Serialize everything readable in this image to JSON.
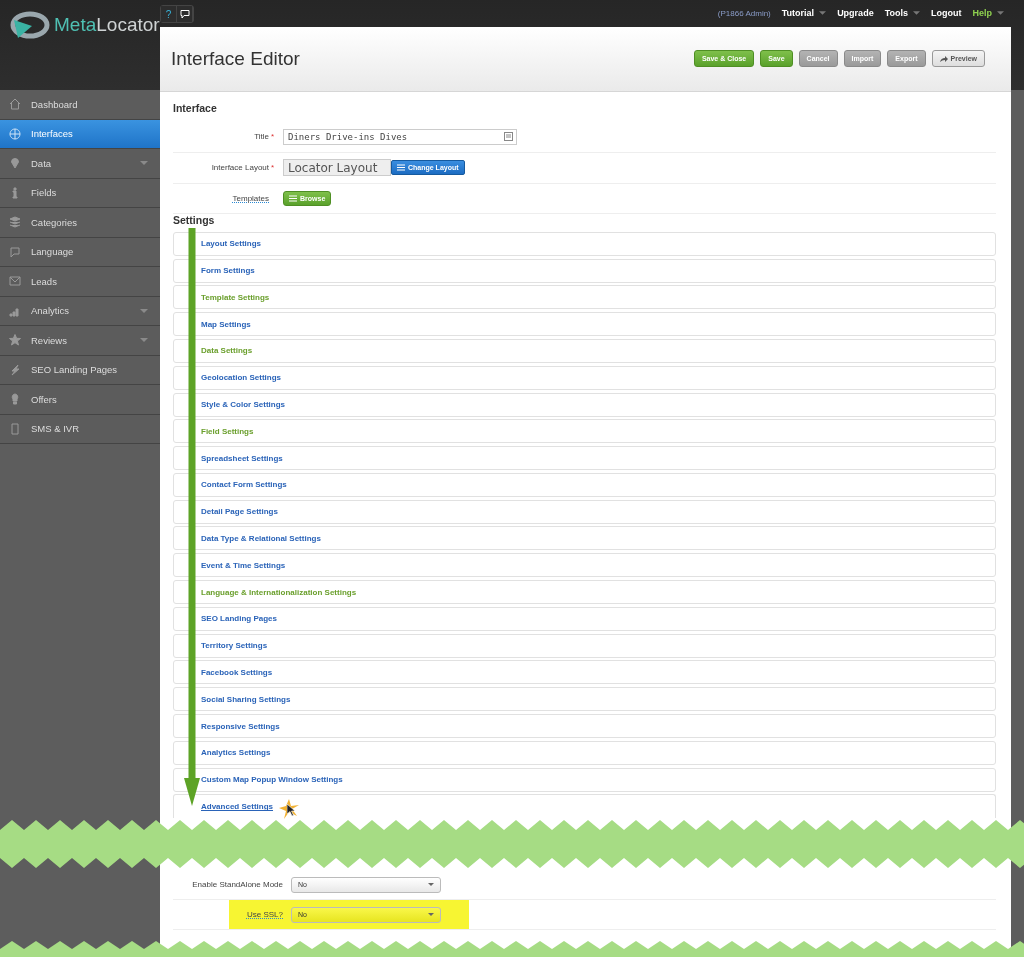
{
  "topbar": {
    "help_buttons": [
      {
        "label": "?"
      }
    ],
    "account": "(P1866 Admin)",
    "menu": [
      {
        "label": "Tutorial",
        "dropdown": true,
        "kind": "normal"
      },
      {
        "label": "Upgrade",
        "dropdown": false,
        "kind": "normal"
      },
      {
        "label": "Tools",
        "dropdown": true,
        "kind": "normal"
      },
      {
        "label": "Logout",
        "dropdown": false,
        "kind": "normal"
      },
      {
        "label": "Help",
        "dropdown": true,
        "kind": "accent"
      }
    ]
  },
  "logo": {
    "part_1": "Meta",
    "part_2": "Locator"
  },
  "sidebar": {
    "items": [
      {
        "label": "Dashboard",
        "selected": false,
        "expandable": false
      },
      {
        "label": "Interfaces",
        "selected": true,
        "expandable": false
      },
      {
        "label": "Data",
        "selected": false,
        "expandable": true
      },
      {
        "label": "Fields",
        "selected": false,
        "expandable": false
      },
      {
        "label": "Categories",
        "selected": false,
        "expandable": false
      },
      {
        "label": "Language",
        "selected": false,
        "expandable": false
      },
      {
        "label": "Leads",
        "selected": false,
        "expandable": false
      },
      {
        "label": "Analytics",
        "selected": false,
        "expandable": true
      },
      {
        "label": "Reviews",
        "selected": false,
        "expandable": true
      },
      {
        "label": "SEO Landing Pages",
        "selected": false,
        "expandable": false
      },
      {
        "label": "Offers",
        "selected": false,
        "expandable": false
      },
      {
        "label": "SMS & IVR",
        "selected": false,
        "expandable": false
      }
    ]
  },
  "editor": {
    "title": "Interface Editor",
    "buttons": [
      {
        "label": "Save & Close",
        "kind": "primary"
      },
      {
        "label": "Save",
        "kind": "primary"
      },
      {
        "label": "Cancel",
        "kind": "muted"
      },
      {
        "label": "Import",
        "kind": "muted"
      },
      {
        "label": "Export",
        "kind": "muted"
      },
      {
        "label": "Preview",
        "kind": "plain"
      }
    ],
    "interface_heading": "Interface",
    "title_field": {
      "label": "Title",
      "required_mark": "*",
      "value": "Diners Drive-ins Dives"
    },
    "layout_field": {
      "label": "Interface Layout",
      "required_mark": "*",
      "value": "Locator Layout",
      "button": "Change Layout"
    },
    "templates_field": {
      "label": "Templates",
      "button": "Browse"
    },
    "settings_heading": "Settings",
    "settings": [
      {
        "label": "Layout Settings",
        "color": "#2a63b8"
      },
      {
        "label": "Form Settings",
        "color": "#2a63b8"
      },
      {
        "label": "Template Settings",
        "color": "#6a9f2c"
      },
      {
        "label": "Map Settings",
        "color": "#2a63b8"
      },
      {
        "label": "Data Settings",
        "color": "#6a9f2c"
      },
      {
        "label": "Geolocation Settings",
        "color": "#2a63b8"
      },
      {
        "label": "Style & Color Settings",
        "color": "#2a63b8"
      },
      {
        "label": "Field Settings",
        "color": "#6a9f2c"
      },
      {
        "label": "Spreadsheet Settings",
        "color": "#2a63b8"
      },
      {
        "label": "Contact Form Settings",
        "color": "#2a63b8"
      },
      {
        "label": "Detail Page Settings",
        "color": "#2a63b8"
      },
      {
        "label": "Data Type & Relational Settings",
        "color": "#2a63b8"
      },
      {
        "label": "Event & Time Settings",
        "color": "#2a63b8"
      },
      {
        "label": "Language & Internationalization Settings",
        "color": "#6a9f2c"
      },
      {
        "label": "SEO Landing Pages",
        "color": "#2a63b8"
      },
      {
        "label": "Territory Settings",
        "color": "#2a63b8"
      },
      {
        "label": "Facebook Settings",
        "color": "#2a63b8"
      },
      {
        "label": "Social Sharing Settings",
        "color": "#2a63b8"
      },
      {
        "label": "Responsive Settings",
        "color": "#2a63b8"
      },
      {
        "label": "Analytics Settings",
        "color": "#2a63b8"
      },
      {
        "label": "Custom Map Popup Window Settings",
        "color": "#2a63b8"
      }
    ],
    "advanced": {
      "label": "Advanced Settings",
      "rows": [
        {
          "label": "Enable StandAlone Mode",
          "value": "No",
          "highlighted": false
        },
        {
          "label": "Use SSL?",
          "value": "No",
          "highlighted": true
        }
      ]
    }
  }
}
